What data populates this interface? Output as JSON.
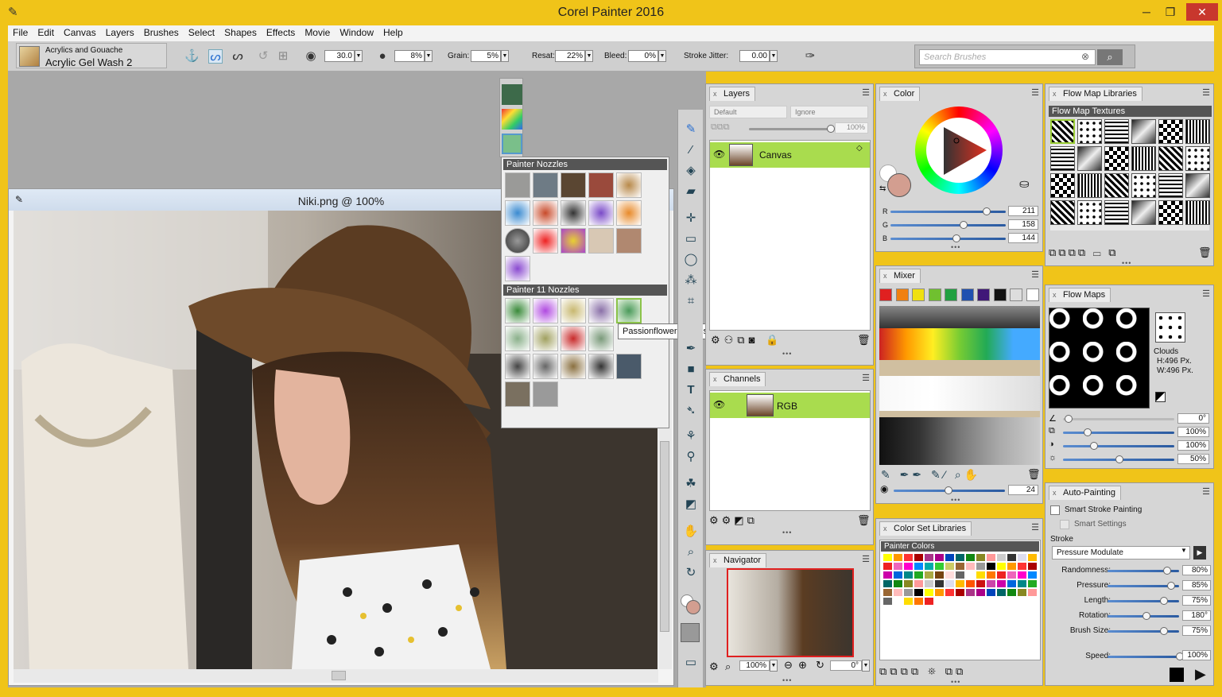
{
  "window": {
    "title": "Corel Painter 2016",
    "minimize": "─",
    "restore": "❐",
    "close": "✕"
  },
  "menu": [
    "File",
    "Edit",
    "Canvas",
    "Layers",
    "Brushes",
    "Select",
    "Shapes",
    "Effects",
    "Movie",
    "Window",
    "Help"
  ],
  "brush": {
    "category": "Acrylics and Gouache",
    "variant": "Acrylic Gel Wash 2"
  },
  "propbar": {
    "size": "30.0",
    "opacity": "8%",
    "grain_label": "Grain:",
    "grain": "5%",
    "resat_label": "Resat:",
    "resat": "22%",
    "bleed_label": "Bleed:",
    "bleed": "0%",
    "jitter_label": "Stroke Jitter:",
    "jitter": "0.00"
  },
  "search": {
    "placeholder": "Search Brushes"
  },
  "document": {
    "title": "Niki.png @ 100%"
  },
  "nozzles": {
    "section1": "Painter Nozzles",
    "section2": "Painter 11 Nozzles",
    "tooltip": "Passionflower Leaves"
  },
  "layers": {
    "tab": "Layers",
    "composite": "Default",
    "method": "Ignore",
    "opacity": "100%",
    "layer_name": "Canvas"
  },
  "channels": {
    "tab": "Channels",
    "channel_name": "RGB"
  },
  "navigator": {
    "tab": "Navigator",
    "zoom": "100%",
    "rotation": "0°"
  },
  "color": {
    "tab": "Color",
    "r_label": "R",
    "g_label": "G",
    "b_label": "B",
    "r": "211",
    "g": "158",
    "b": "144",
    "r_frac": 0.83,
    "g_frac": 0.62,
    "b_frac": 0.56,
    "main": "#d39e90"
  },
  "mixer": {
    "tab": "Mixer",
    "brush_size": "24",
    "colors": [
      "#e02020",
      "#f08010",
      "#f0e010",
      "#70c030",
      "#20a040",
      "#2050b0",
      "#401878",
      "#111111",
      "#dddddd",
      "#ffffff"
    ]
  },
  "colorset": {
    "tab": "Color Set Libraries",
    "library": "Painter Colors"
  },
  "flowlib": {
    "tab": "Flow Map Libraries",
    "textures_label": "Flow Map Textures"
  },
  "flowmaps": {
    "tab": "Flow Maps",
    "name": "Clouds",
    "height": "H:496 Px.",
    "width": "W:496 Px.",
    "angle": "0°",
    "v1": "100%",
    "v2": "100%",
    "v3": "50%"
  },
  "autopaint": {
    "tab": "Auto-Painting",
    "smart_stroke": "Smart Stroke Painting",
    "smart_settings": "Smart Settings",
    "stroke_label": "Stroke",
    "stroke": "Pressure Modulate",
    "params": [
      {
        "label": "Randomness:",
        "value": "80%",
        "frac": 0.8
      },
      {
        "label": "Pressure:",
        "value": "85%",
        "frac": 0.85
      },
      {
        "label": "Length:",
        "value": "75%",
        "frac": 0.75
      },
      {
        "label": "Rotation:",
        "value": "180°",
        "frac": 0.5
      },
      {
        "label": "Brush Size:",
        "value": "75%",
        "frac": 0.75
      }
    ],
    "speed_label": "Speed:",
    "speed": "100%"
  }
}
